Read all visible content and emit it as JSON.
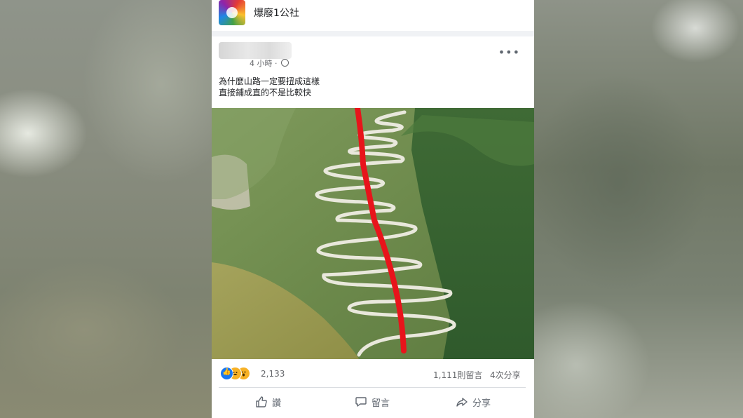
{
  "page": {
    "name": "爆廢1公社"
  },
  "post": {
    "time": "4 小時",
    "text_line1": "為什麼山路一定要扭成這樣",
    "text_line2": "直接鋪成直的不是比較快"
  },
  "engagement": {
    "reaction_count": "2,133",
    "comments": "1,111則留言",
    "shares": "4次分享"
  },
  "actions": {
    "like": "讚",
    "comment": "留言",
    "share": "分享"
  },
  "icons": [
    "globe-icon",
    "more-icon",
    "like-icon",
    "comment-icon",
    "share-icon"
  ],
  "colors": {
    "accent": "#1877f2",
    "red_line": "#e8141b"
  }
}
